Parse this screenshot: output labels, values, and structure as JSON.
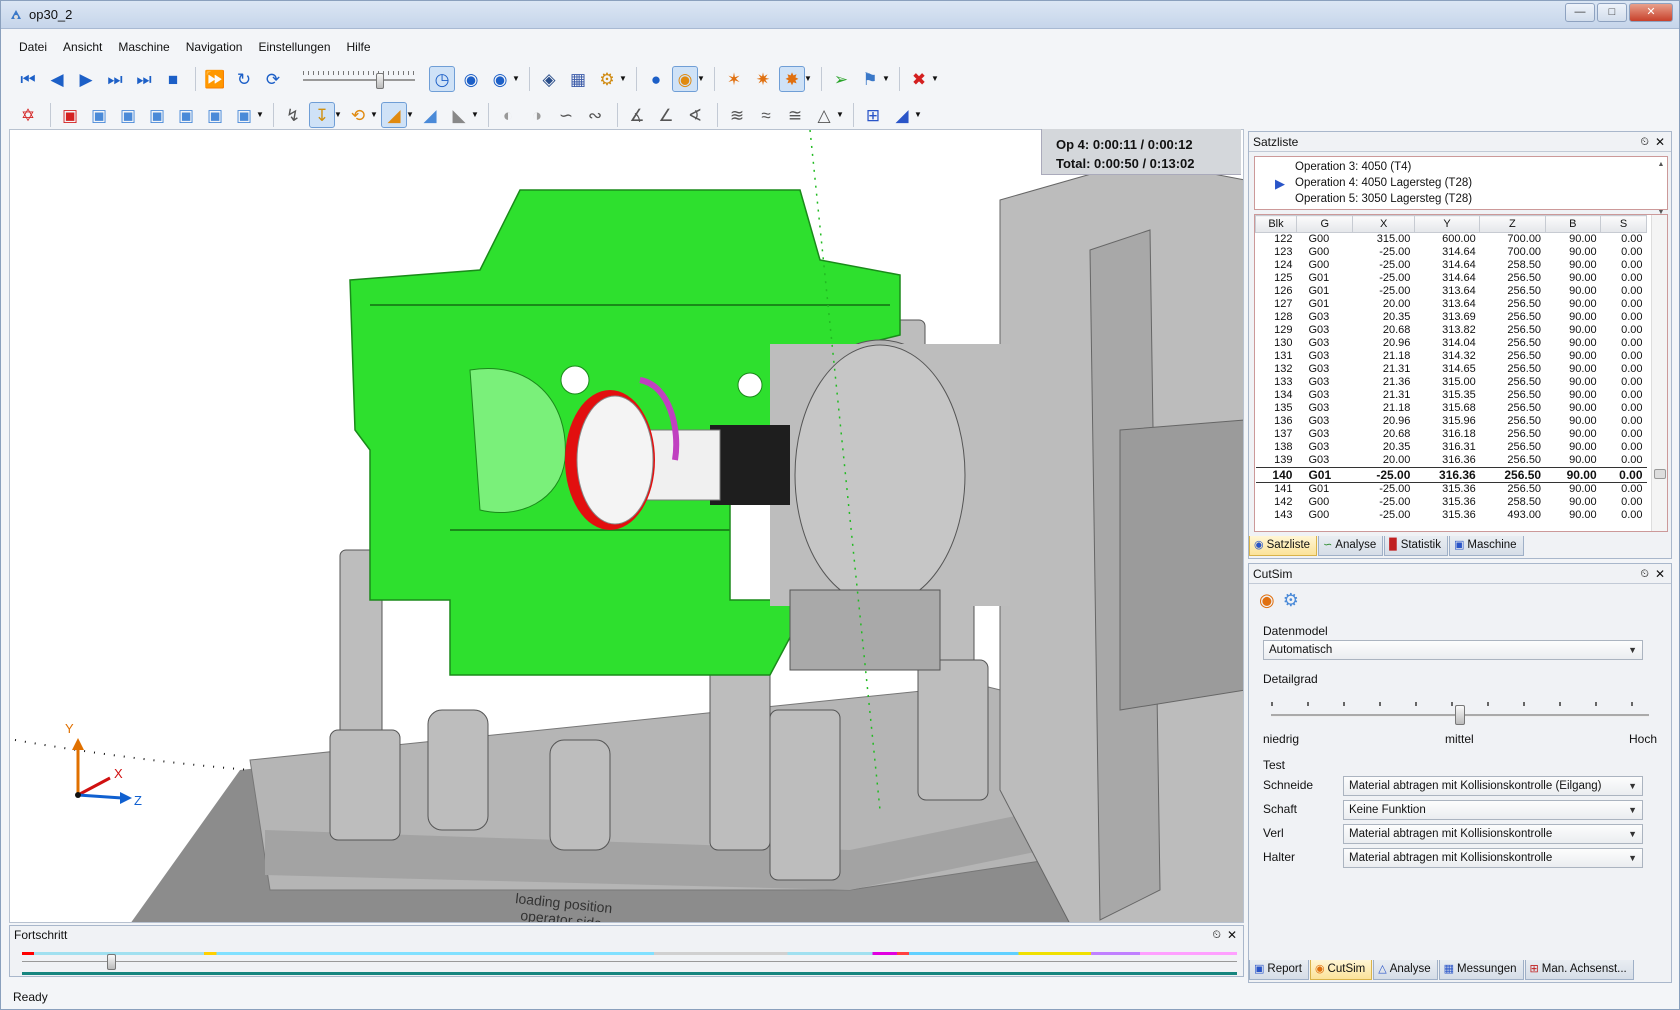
{
  "window": {
    "title": "op30_2"
  },
  "menu": [
    "Datei",
    "Ansicht",
    "Maschine",
    "Navigation",
    "Einstellungen",
    "Hilfe"
  ],
  "viewport": {
    "time_op": "Op 4: 0:00:11 / 0:00:12",
    "time_total": "Total: 0:00:50 / 0:13:02",
    "axis_y": "Y",
    "axis_x": "X",
    "axis_z": "Z",
    "plate_text1": "loading position",
    "plate_text2": "operator side"
  },
  "satzliste": {
    "title": "Satzliste",
    "operations": [
      "Operation 3: 4050  (T4)",
      "Operation 4: 4050 Lagersteg  (T28)",
      "Operation 5: 3050 Lagersteg  (T28)"
    ],
    "current_operation_index": 1,
    "columns": [
      "Blk",
      "G",
      "X",
      "Y",
      "Z",
      "B",
      "S"
    ],
    "rows": [
      [
        "122",
        "G00",
        "315.00",
        "600.00",
        "700.00",
        "90.00",
        "0.00"
      ],
      [
        "123",
        "G00",
        "-25.00",
        "314.64",
        "700.00",
        "90.00",
        "0.00"
      ],
      [
        "124",
        "G00",
        "-25.00",
        "314.64",
        "258.50",
        "90.00",
        "0.00"
      ],
      [
        "125",
        "G01",
        "-25.00",
        "314.64",
        "256.50",
        "90.00",
        "0.00"
      ],
      [
        "126",
        "G01",
        "-25.00",
        "313.64",
        "256.50",
        "90.00",
        "0.00"
      ],
      [
        "127",
        "G01",
        "20.00",
        "313.64",
        "256.50",
        "90.00",
        "0.00"
      ],
      [
        "128",
        "G03",
        "20.35",
        "313.69",
        "256.50",
        "90.00",
        "0.00"
      ],
      [
        "129",
        "G03",
        "20.68",
        "313.82",
        "256.50",
        "90.00",
        "0.00"
      ],
      [
        "130",
        "G03",
        "20.96",
        "314.04",
        "256.50",
        "90.00",
        "0.00"
      ],
      [
        "131",
        "G03",
        "21.18",
        "314.32",
        "256.50",
        "90.00",
        "0.00"
      ],
      [
        "132",
        "G03",
        "21.31",
        "314.65",
        "256.50",
        "90.00",
        "0.00"
      ],
      [
        "133",
        "G03",
        "21.36",
        "315.00",
        "256.50",
        "90.00",
        "0.00"
      ],
      [
        "134",
        "G03",
        "21.31",
        "315.35",
        "256.50",
        "90.00",
        "0.00"
      ],
      [
        "135",
        "G03",
        "21.18",
        "315.68",
        "256.50",
        "90.00",
        "0.00"
      ],
      [
        "136",
        "G03",
        "20.96",
        "315.96",
        "256.50",
        "90.00",
        "0.00"
      ],
      [
        "137",
        "G03",
        "20.68",
        "316.18",
        "256.50",
        "90.00",
        "0.00"
      ],
      [
        "138",
        "G03",
        "20.35",
        "316.31",
        "256.50",
        "90.00",
        "0.00"
      ],
      [
        "139",
        "G03",
        "20.00",
        "316.36",
        "256.50",
        "90.00",
        "0.00"
      ],
      [
        "140",
        "G01",
        "-25.00",
        "316.36",
        "256.50",
        "90.00",
        "0.00"
      ],
      [
        "141",
        "G01",
        "-25.00",
        "315.36",
        "256.50",
        "90.00",
        "0.00"
      ],
      [
        "142",
        "G00",
        "-25.00",
        "315.36",
        "258.50",
        "90.00",
        "0.00"
      ],
      [
        "143",
        "G00",
        "-25.00",
        "315.36",
        "493.00",
        "90.00",
        "0.00"
      ]
    ],
    "current_row_index": 18,
    "tabs": [
      "Satzliste",
      "Analyse",
      "Statistik",
      "Maschine"
    ]
  },
  "cutsim": {
    "title": "CutSim",
    "datenmodel_label": "Datenmodel",
    "datenmodel_value": "Automatisch",
    "detailgrad_label": "Detailgrad",
    "detail_low": "niedrig",
    "detail_mid": "mittel",
    "detail_high": "Hoch",
    "detail_level_fraction": 0.5,
    "test_label": "Test",
    "fields": [
      {
        "label": "Schneide",
        "value": "Material abtragen mit Kollisionskontrolle (Eilgang)"
      },
      {
        "label": "Schaft",
        "value": "Keine Funktion"
      },
      {
        "label": "Verl",
        "value": "Material abtragen mit Kollisionskontrolle"
      },
      {
        "label": "Halter",
        "value": "Material abtragen mit Kollisionskontrolle"
      }
    ],
    "tabs": [
      "Report",
      "CutSim",
      "Analyse",
      "Messungen",
      "Man. Achsenst..."
    ]
  },
  "fortschritt": {
    "title": "Fortschritt",
    "position_fraction": 0.07
  },
  "status": "Ready",
  "colors": {
    "workpiece": "#22dd22",
    "machine_gray": "#b8b8b8",
    "tool_red": "#e01010",
    "active_tab": "#fbe39a",
    "progress": "#16857f"
  }
}
